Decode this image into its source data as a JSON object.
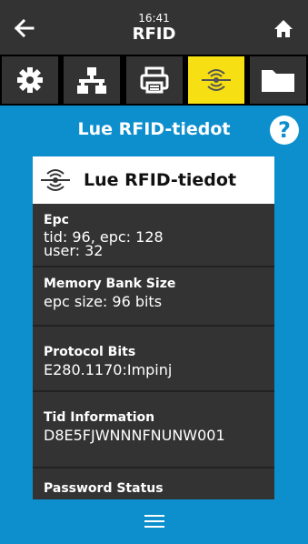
{
  "header": {
    "time": "16:41",
    "title": "RFID",
    "back_icon": "arrow-left-icon",
    "home_icon": "home-icon"
  },
  "tabs": [
    {
      "name": "settings",
      "icon": "gear-icon",
      "active": false
    },
    {
      "name": "network",
      "icon": "network-icon",
      "active": false
    },
    {
      "name": "print",
      "icon": "printer-icon",
      "active": false
    },
    {
      "name": "rfid",
      "icon": "rfid-icon",
      "active": true
    },
    {
      "name": "storage",
      "icon": "folder-icon",
      "active": false
    }
  ],
  "page": {
    "subtitle": "Lue RFID-tiedot",
    "card_title": "Lue RFID-tiedot"
  },
  "items": [
    {
      "label": "Epc",
      "value": "tid: 96, epc: 128\nuser: 32"
    },
    {
      "label": "Memory Bank Size",
      "value": "epc size: 96 bits"
    },
    {
      "label": "Protocol Bits",
      "value": "E280.1170:Impinj"
    },
    {
      "label": "Tid Information",
      "value": "D8E5FJWNNNFNUNW001"
    },
    {
      "label": "Password Status",
      "value": ""
    }
  ],
  "colors": {
    "accent_blue": "#0e8fcd",
    "active_tab_yellow": "#f6df12",
    "panel_dark": "#333333"
  }
}
